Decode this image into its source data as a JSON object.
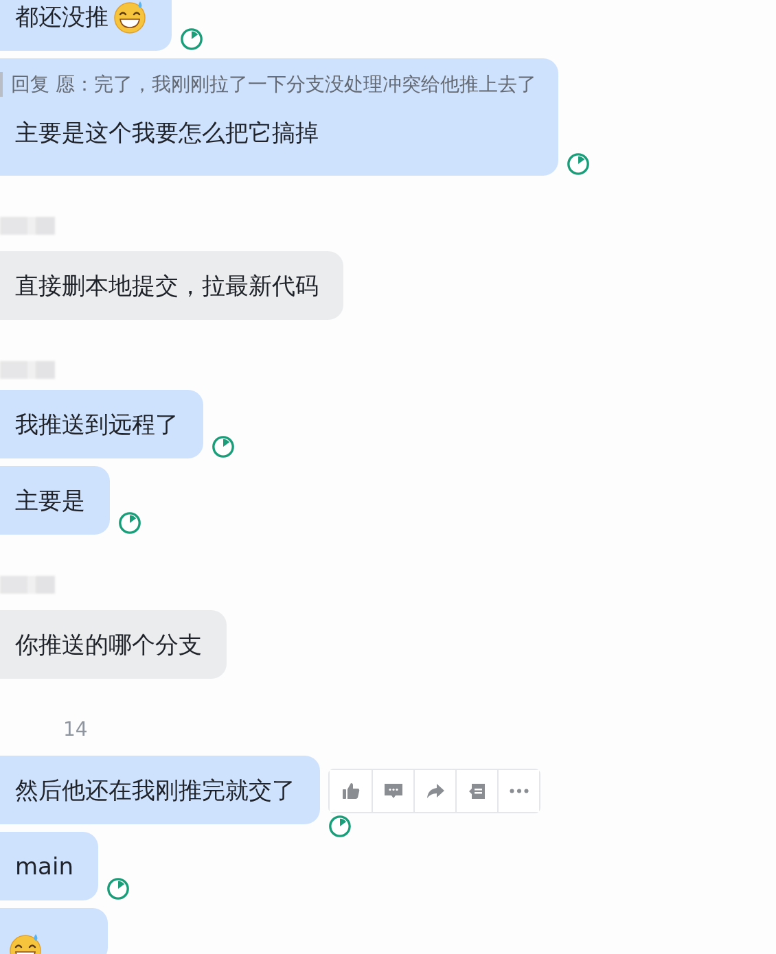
{
  "messages": [
    {
      "kind": "mine",
      "text": "都还没推",
      "emoji": true,
      "hovered": false
    },
    {
      "kind": "mine",
      "quote": "回复 愿：完了，我刚刚拉了一下分支没处理冲突给他推上去了",
      "text": "主要是这个我要怎么把它搞掉",
      "emoji": false,
      "hovered": false
    },
    {
      "kind": "redacted"
    },
    {
      "kind": "theirs",
      "text": "直接删本地提交，拉最新代码"
    },
    {
      "kind": "redacted"
    },
    {
      "kind": "mine",
      "text": "我推送到远程了",
      "emoji": false,
      "hovered": false
    },
    {
      "kind": "mine",
      "text": "主要是",
      "emoji": false,
      "hovered": false
    },
    {
      "kind": "redacted"
    },
    {
      "kind": "theirs",
      "text": "你推送的哪个分支"
    },
    {
      "kind": "time",
      "text": "14"
    },
    {
      "kind": "mine",
      "text": "然后他还在我刚推完就交了",
      "emoji": false,
      "hovered": true
    },
    {
      "kind": "mine",
      "text": "main",
      "emoji": false,
      "hovered": false
    },
    {
      "kind": "mine",
      "emoji": true,
      "cut": true,
      "hovered": false
    }
  ]
}
